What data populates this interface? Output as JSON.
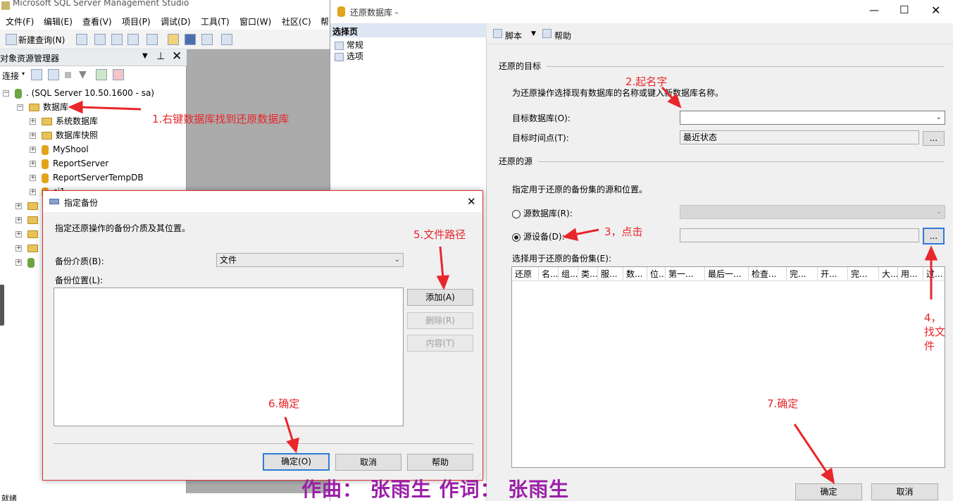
{
  "ssms": {
    "title": "Microsoft SQL Server Management Studio",
    "menu": [
      "文件(F)",
      "编辑(E)",
      "查看(V)",
      "项目(P)",
      "调试(D)",
      "工具(T)",
      "窗口(W)",
      "社区(C)",
      "帮"
    ],
    "toolbar": {
      "new_query": "新建查询(N)"
    },
    "explorer": {
      "title": "对象资源管理器",
      "connect": "连接",
      "server": ". (SQL Server 10.50.1600 - sa)",
      "databases": "数据库",
      "items": [
        "系统数据库",
        "数据库快照",
        "MyShool",
        "ReportServer",
        "ReportServerTempDB",
        "ci1"
      ]
    },
    "status": "就绪"
  },
  "restore": {
    "title": "还原数据库 -",
    "select_page": "选择页",
    "pages": [
      "常规",
      "选项"
    ],
    "toolbar": {
      "script": "脚本",
      "help": "帮助"
    },
    "dest_group": "还原的目标",
    "dest_desc": "为还原操作选择现有数据库的名称或键入新数据库名称。",
    "target_db_label": "目标数据库(O):",
    "target_db_value": "",
    "target_time_label": "目标时间点(T):",
    "target_time_value": "最近状态",
    "browse": "...",
    "source_group": "还原的源",
    "source_desc": "指定用于还原的备份集的源和位置。",
    "source_db_label": "源数据库(R):",
    "source_device_label": "源设备(D):",
    "backup_sets_label": "选择用于还原的备份集(E):",
    "columns": [
      "还原",
      "名...",
      "组...",
      "类...",
      "服...",
      "数...",
      "位...",
      "第一...",
      "最后一...",
      "检查...",
      "完...",
      "开...",
      "完...",
      "大...",
      "用...",
      "过..."
    ],
    "ok": "确定",
    "cancel": "取消"
  },
  "backup_dialog": {
    "title": "指定备份",
    "desc": "指定还原操作的备份介质及其位置。",
    "media_label": "备份介质(B):",
    "media_value": "文件",
    "location_label": "备份位置(L):",
    "add": "添加(A)",
    "remove": "删除(R)",
    "contents": "内容(T)",
    "ok": "确定(O)",
    "cancel": "取消",
    "help": "帮助"
  },
  "annotations": {
    "a1": "1.右键数据库找到还原数据库",
    "a2": "2.起名字",
    "a3": "3，点击",
    "a4a": "4，",
    "a4b": "找文",
    "a4c": "件",
    "a5": "5.文件路径",
    "a6": "6.确定",
    "a7": "7.确定"
  },
  "caption": "作曲： 张雨生 作词： 张雨生",
  "colors": {
    "annotation": "#e8262b",
    "focus": "#2e7bd6",
    "caption": "#9b1fa8"
  }
}
